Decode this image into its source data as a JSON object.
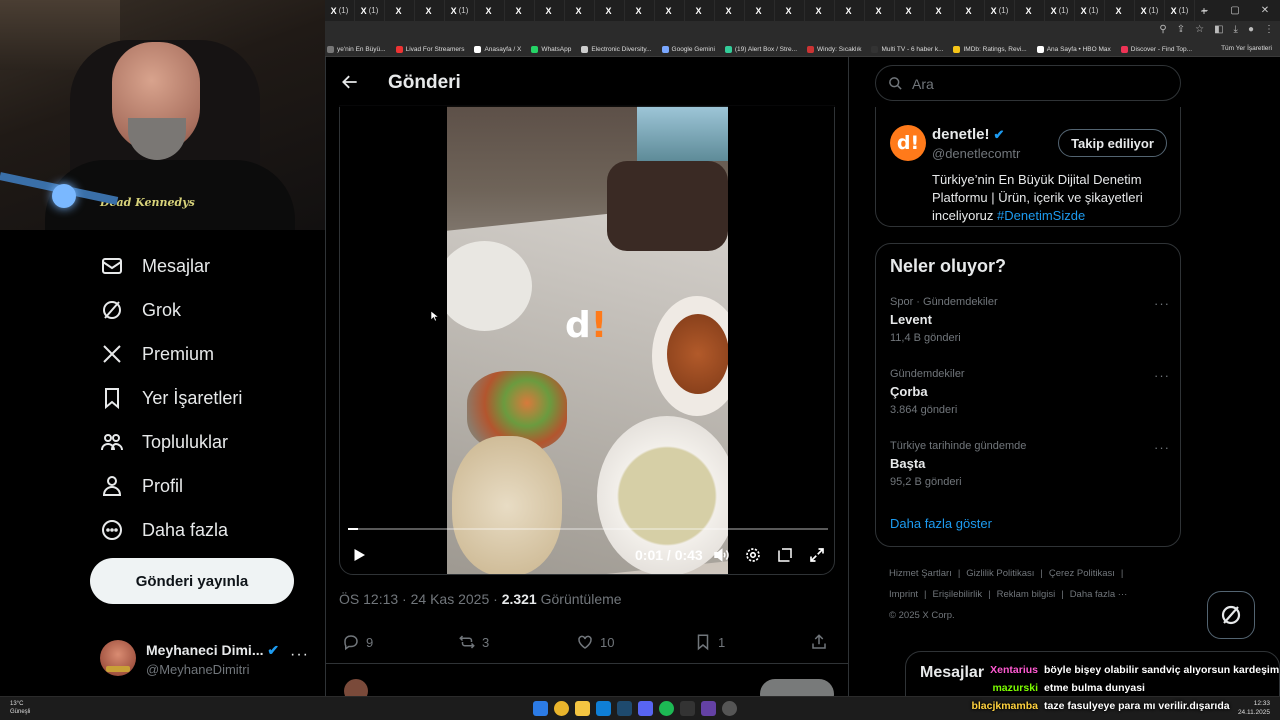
{
  "browser": {
    "tabs": [
      "(1)",
      "(1)",
      "",
      "",
      "(1)",
      "",
      "",
      "",
      "",
      "",
      "",
      "",
      "",
      "",
      "",
      "",
      "",
      "",
      "",
      "",
      "",
      "",
      "(1)",
      "",
      "(1)",
      "(1)",
      "",
      "(1)",
      "(1)"
    ],
    "bookmarks": [
      {
        "label": "ye'nin En Büyü...",
        "color": "#777"
      },
      {
        "label": "Livad For Streamers",
        "color": "#e33"
      },
      {
        "label": "Anasayfa / X",
        "color": "#fff"
      },
      {
        "label": "WhatsApp",
        "color": "#25d366"
      },
      {
        "label": "Electronic Diversity...",
        "color": "#ccc"
      },
      {
        "label": "Google Gemini",
        "color": "#7aa7ff"
      },
      {
        "label": "(19) Alert Box / Stre...",
        "color": "#3c9"
      },
      {
        "label": "Windy: Sıcaklık",
        "color": "#c33"
      },
      {
        "label": "Multi TV - 6 haber k...",
        "color": "#333"
      },
      {
        "label": "IMDb: Ratings, Revi...",
        "color": "#f5c518"
      },
      {
        "label": "Ana Sayfa • HBO Max",
        "color": "#fff"
      },
      {
        "label": "Discover - Find Top...",
        "color": "#e35"
      }
    ],
    "all_bookmarks": "Tüm Yer İşaretleri"
  },
  "webcam": {
    "shirt_text": "Dead Kennedys"
  },
  "nav": {
    "items": [
      {
        "label": "Mesajlar",
        "icon": "mail-icon"
      },
      {
        "label": "Grok",
        "icon": "grok-icon"
      },
      {
        "label": "Premium",
        "icon": "x-logo-icon"
      },
      {
        "label": "Yer İşaretleri",
        "icon": "bookmark-icon"
      },
      {
        "label": "Topluluklar",
        "icon": "communities-icon"
      },
      {
        "label": "Profil",
        "icon": "profile-icon"
      },
      {
        "label": "Daha fazla",
        "icon": "more-circle-icon"
      }
    ],
    "post_button": "Gönderi yayınla",
    "account": {
      "name": "Meyhaneci Dimi...",
      "handle": "@MeyhaneDimitri"
    }
  },
  "main": {
    "title": "Gönderi",
    "video": {
      "time": "0:01 / 0:43",
      "progress": 0.02
    },
    "meta": {
      "time": "ÖS 12:13",
      "date": "24 Kas 2025",
      "views": "2.321",
      "views_label": "Görüntüleme"
    },
    "actions": {
      "replies": "9",
      "reposts": "3",
      "likes": "10",
      "bookmarks": "1"
    }
  },
  "right": {
    "search_placeholder": "Ara",
    "profile": {
      "name": "denetle!",
      "handle": "@denetlecomtr",
      "follow_label": "Takip ediliyor",
      "bio": "Türkiye’nin En Büyük Dijital Denetim Platformu | Ürün, içerik ve şikayetleri inceliyoruz",
      "hashtag": "#DenetimSizde"
    },
    "trends_title": "Neler oluyor?",
    "trends": [
      {
        "category": "Spor · Gündemdekiler",
        "name": "Levent",
        "count": "11,4 B gönderi"
      },
      {
        "category": "Gündemdekiler",
        "name": "Çorba",
        "count": "3.864 gönderi"
      },
      {
        "category": "Türkiye tarihinde gündemde",
        "name": "Başta",
        "count": "95,2 B gönderi"
      }
    ],
    "show_more": "Daha fazla göster",
    "footer": [
      "Hizmet Şartları",
      "|",
      "Gizlilik Politikası",
      "|",
      "Çerez Politikası",
      "|",
      "Imprint",
      "|",
      "Erişilebilirlik",
      "|",
      "Reklam bilgisi",
      "|",
      "Daha fazla ···",
      "© 2025 X Corp."
    ],
    "messages_title": "Mesajlar"
  },
  "chat": [
    {
      "user": "Xentarius",
      "color": "#ff5ad2",
      "message": "böyle bişey olabilir sandviç alıyorsun kardeşim"
    },
    {
      "user": "mazurski",
      "color": "#7cfc00",
      "message": "etme bulma dunyasi"
    },
    {
      "user": "blacjkmamba",
      "color": "#ffd23f",
      "message": "taze fasulyeye para mı verilir.dışarıda"
    }
  ],
  "taskbar": {
    "temp": "13°C",
    "weather": "Güneşli",
    "time": "12:33",
    "date": "24.11.2025"
  }
}
